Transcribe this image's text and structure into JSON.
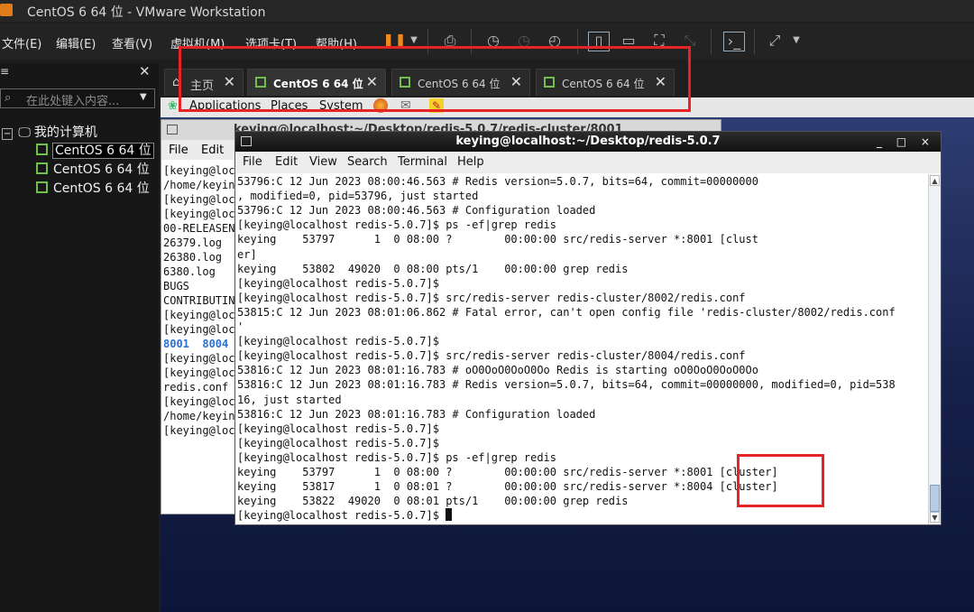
{
  "window": {
    "title": "CentOS 6 64 位 - VMware Workstation"
  },
  "menubar": {
    "items": [
      "文件(E)",
      "编辑(E)",
      "查看(V)",
      "虚拟机(M)",
      "选项卡(T)",
      "帮助(H)"
    ]
  },
  "library": {
    "search_placeholder": "在此处键入内容...",
    "root": "我的计算机",
    "vms": [
      "CentOS 6 64 位",
      "CentOS 6 64 位",
      "CentOS 6 64 位"
    ]
  },
  "tabs": [
    {
      "label": "主页"
    },
    {
      "label": "CentOS 6 64 位"
    },
    {
      "label": "CentOS 6 64 位"
    },
    {
      "label": "CentOS 6 64 位"
    }
  ],
  "gnome_panel": {
    "items": [
      "Applications",
      "Places",
      "System"
    ]
  },
  "back_terminal": {
    "title": "keying@localhost:~/Desktop/redis-5.0.7/redis-cluster/8001",
    "menu": [
      "File",
      "Edit"
    ],
    "lines": [
      "[keying@loc",
      "/home/keyin",
      "[keying@loc",
      "[keying@loc",
      "00-RELEASEN",
      "26379.log",
      "26380.log",
      "6380.log",
      "BUGS",
      "CONTRIBUTIN",
      "[keying@loc",
      "[keying@loc",
      "8001  8004",
      "[keying@loc",
      "[keying@loc",
      "redis.conf",
      "[keying@loc",
      "/home/keyin",
      "[keying@loc"
    ]
  },
  "terminal": {
    "title": "keying@localhost:~/Desktop/redis-5.0.7",
    "controls": "_ □ ×",
    "menu": [
      "File",
      "Edit",
      "View",
      "Search",
      "Terminal",
      "Help"
    ],
    "lines": [
      "53796:C 12 Jun 2023 08:00:46.563 # Redis version=5.0.7, bits=64, commit=00000000",
      ", modified=0, pid=53796, just started",
      "53796:C 12 Jun 2023 08:00:46.563 # Configuration loaded",
      "[keying@localhost redis-5.0.7]$ ps -ef|grep redis",
      "keying    53797      1  0 08:00 ?        00:00:00 src/redis-server *:8001 [clust",
      "er]",
      "keying    53802  49020  0 08:00 pts/1    00:00:00 grep redis",
      "[keying@localhost redis-5.0.7]$",
      "[keying@localhost redis-5.0.7]$ src/redis-server redis-cluster/8002/redis.conf",
      "53815:C 12 Jun 2023 08:01:06.862 # Fatal error, can't open config file 'redis-cluster/8002/redis.conf",
      "'",
      "[keying@localhost redis-5.0.7]$",
      "[keying@localhost redis-5.0.7]$ src/redis-server redis-cluster/8004/redis.conf",
      "53816:C 12 Jun 2023 08:01:16.783 # oO0OoO0OoO0Oo Redis is starting oO0OoO0OoO0Oo",
      "53816:C 12 Jun 2023 08:01:16.783 # Redis version=5.0.7, bits=64, commit=00000000, modified=0, pid=538",
      "16, just started",
      "53816:C 12 Jun 2023 08:01:16.783 # Configuration loaded",
      "[keying@localhost redis-5.0.7]$",
      "[keying@localhost redis-5.0.7]$",
      "[keying@localhost redis-5.0.7]$ ps -ef|grep redis",
      "keying    53797      1  0 08:00 ?        00:00:00 src/redis-server *:8001 [cluster]",
      "keying    53817      1  0 08:01 ?        00:00:00 src/redis-server *:8004 [cluster]",
      "keying    53822  49020  0 08:01 pts/1    00:00:00 grep redis",
      "[keying@localhost redis-5.0.7]$ "
    ]
  },
  "colors": {
    "highlight": "#e52525",
    "vm_icon": "#6fbf4a"
  }
}
